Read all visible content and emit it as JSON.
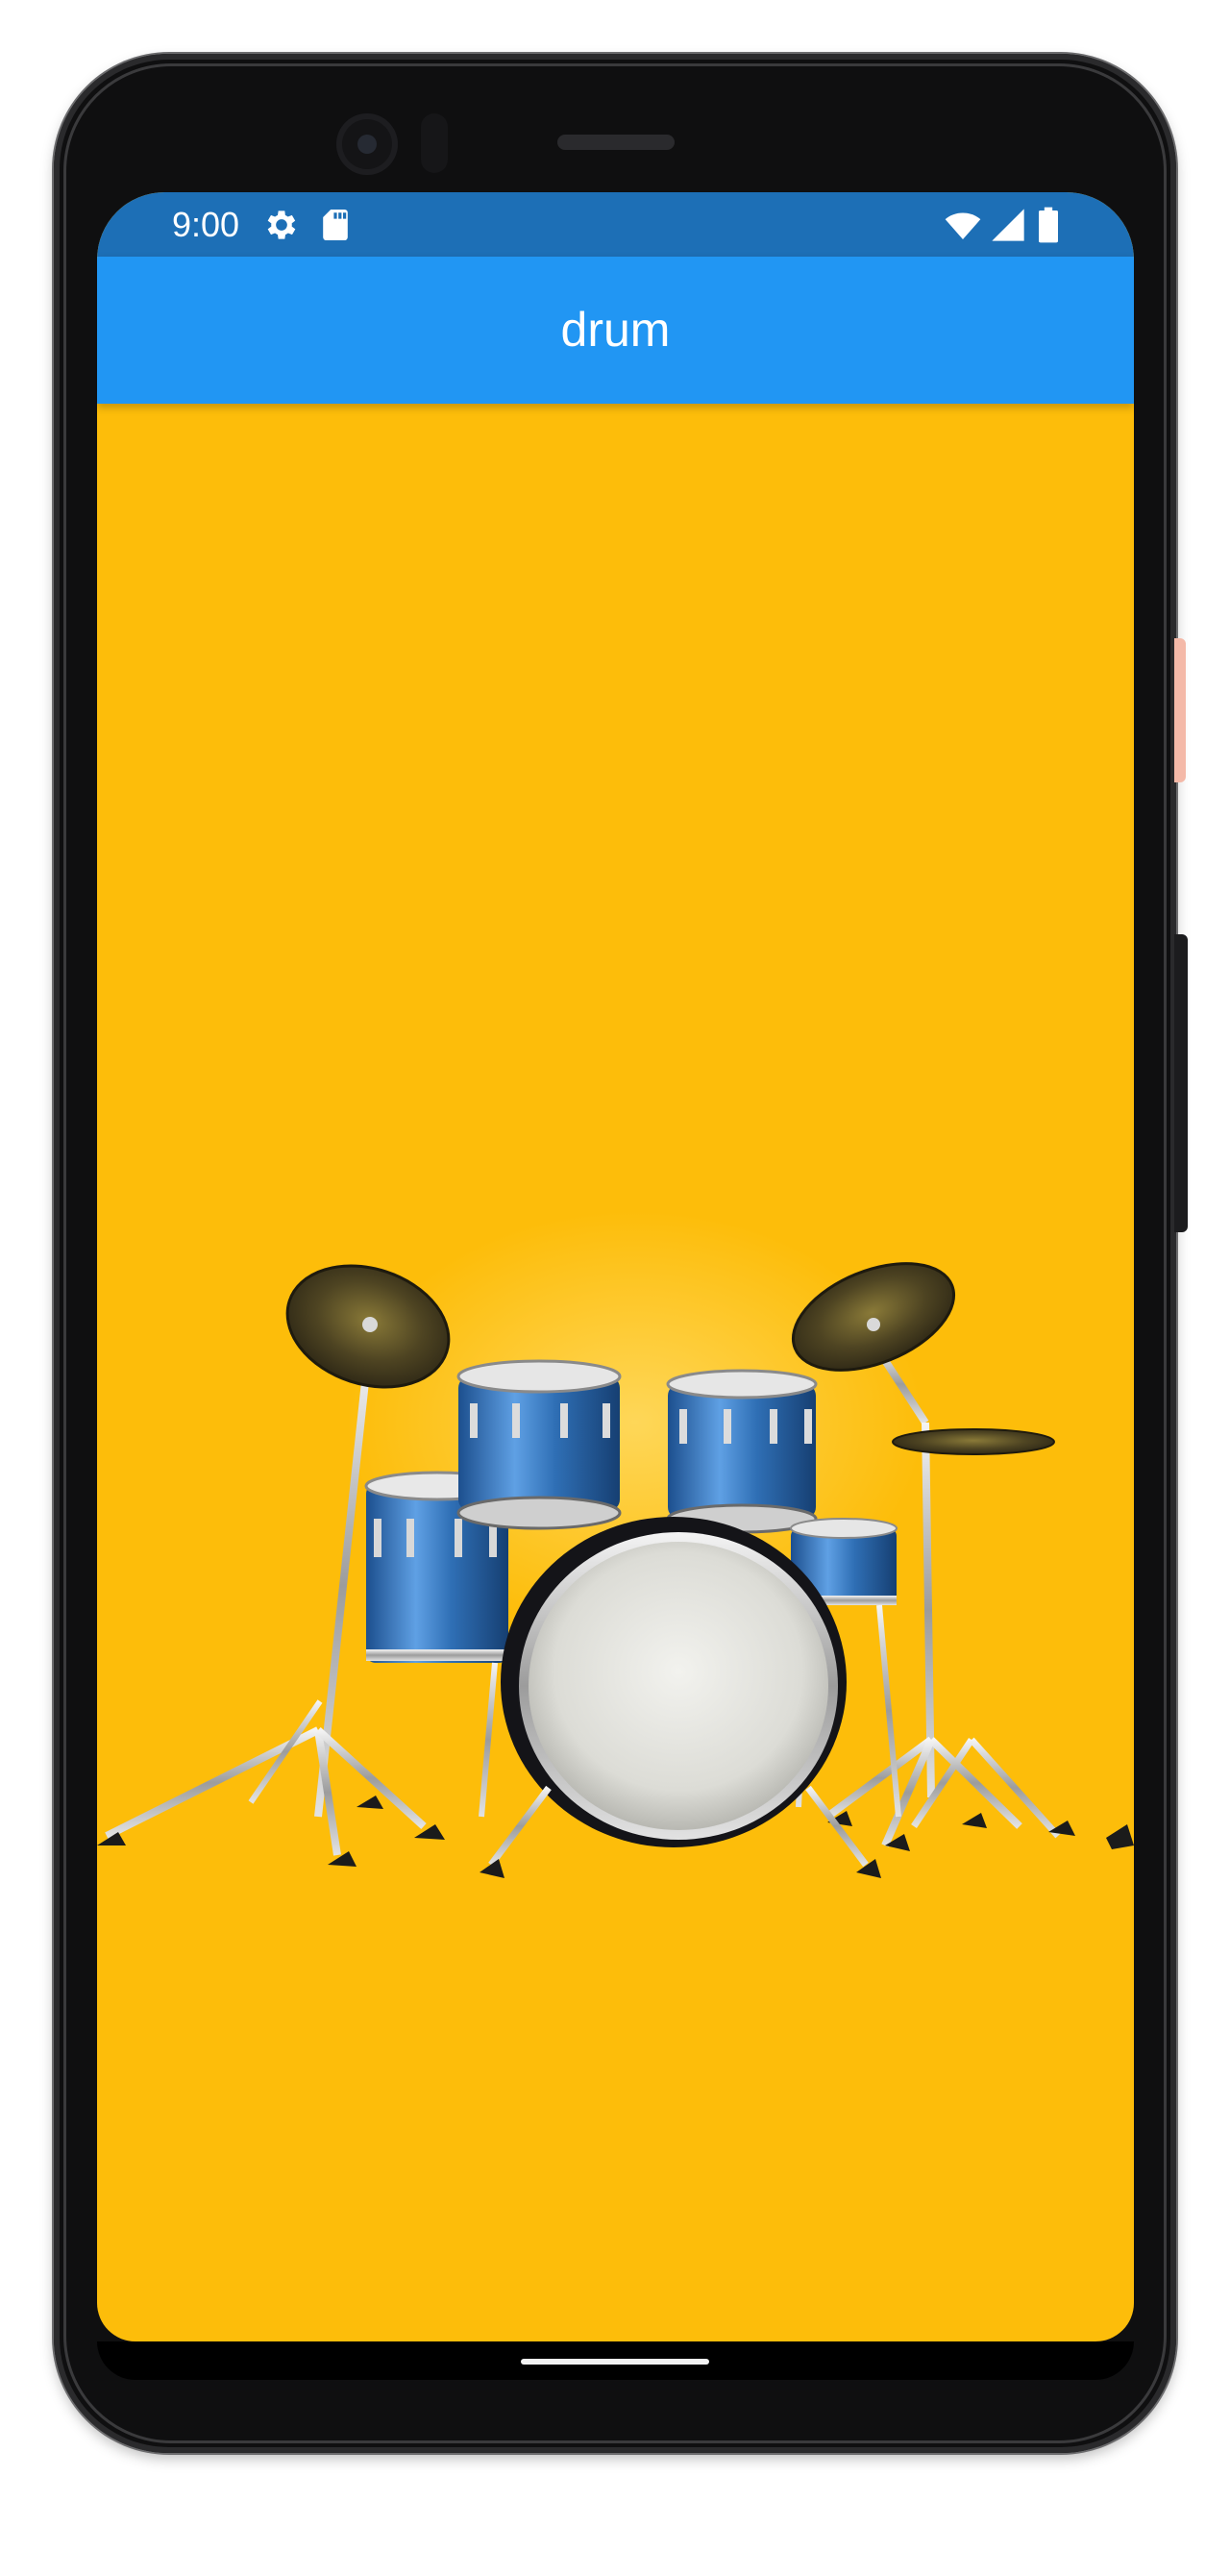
{
  "status_bar": {
    "time": "9:00",
    "left_icons": [
      "gear-icon",
      "sd-card-icon"
    ],
    "right_icons": [
      "wifi-icon",
      "cell-signal-icon",
      "battery-icon"
    ],
    "color": "#1d6fb6"
  },
  "app_bar": {
    "title": "drum",
    "color": "#2196f3"
  },
  "content": {
    "background_color": "#fdbd0a",
    "image": "drum-kit"
  }
}
